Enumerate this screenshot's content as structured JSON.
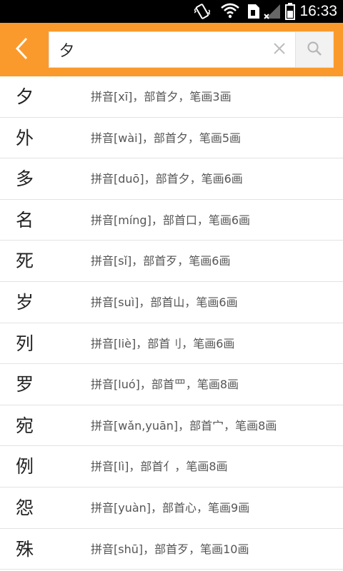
{
  "status_bar": {
    "time": "16:33",
    "icons": [
      "vibrate-icon",
      "wifi-icon",
      "sim-card-icon",
      "signal-icon",
      "battery-icon"
    ]
  },
  "header": {
    "accent_color": "#fb9a2c",
    "back_icon": "chevron-left-icon",
    "search": {
      "value": "夕",
      "clear_icon": "close-icon",
      "search_icon": "magnifier-icon"
    }
  },
  "results": [
    {
      "char": "夕",
      "desc": "拼音[xī]，部首夕，笔画3画"
    },
    {
      "char": "外",
      "desc": "拼音[wài]，部首夕，笔画5画"
    },
    {
      "char": "多",
      "desc": "拼音[duō]，部首夕，笔画6画"
    },
    {
      "char": "名",
      "desc": "拼音[míng]，部首口，笔画6画"
    },
    {
      "char": "死",
      "desc": "拼音[sǐ]，部首歹，笔画6画"
    },
    {
      "char": "岁",
      "desc": "拼音[suì]，部首山，笔画6画"
    },
    {
      "char": "列",
      "desc": "拼音[liè]，部首刂，笔画6画"
    },
    {
      "char": "罗",
      "desc": "拼音[luó]，部首罒，笔画8画"
    },
    {
      "char": "宛",
      "desc": "拼音[wǎn,yuān]，部首宀，笔画8画"
    },
    {
      "char": "例",
      "desc": "拼音[lì]，部首亻，笔画8画"
    },
    {
      "char": "怨",
      "desc": "拼音[yuàn]，部首心，笔画9画"
    },
    {
      "char": "殊",
      "desc": "拼音[shū]，部首歹，笔画10画"
    }
  ]
}
